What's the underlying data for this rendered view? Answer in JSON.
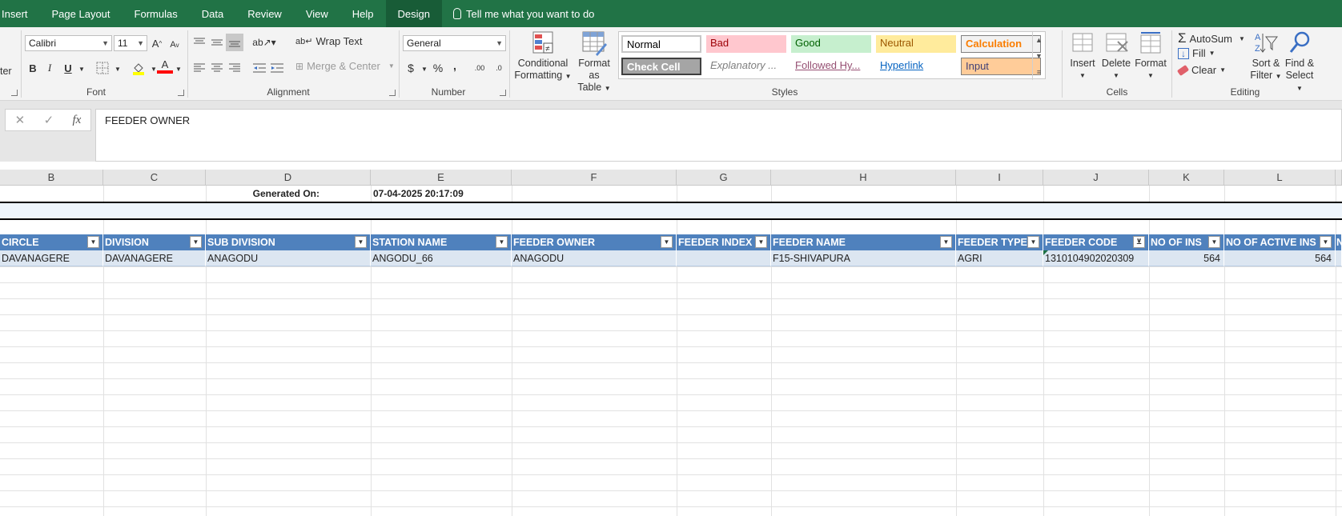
{
  "tabs": [
    {
      "label": "Insert"
    },
    {
      "label": "Page Layout"
    },
    {
      "label": "Formulas"
    },
    {
      "label": "Data"
    },
    {
      "label": "Review"
    },
    {
      "label": "View"
    },
    {
      "label": "Help"
    },
    {
      "label": "Design"
    }
  ],
  "tell_me": "Tell me what you want to do",
  "ribbon": {
    "clipboard_partial": "ter",
    "font": {
      "name": "Calibri",
      "size": "11",
      "group_label": "Font",
      "grow": "A",
      "shrink": "A",
      "bold": "B",
      "italic": "I",
      "underline": "U",
      "font_color": "A"
    },
    "alignment": {
      "wrap_text": "Wrap Text",
      "merge_center": "Merge & Center",
      "group_label": "Alignment"
    },
    "number": {
      "format": "General",
      "currency": "$",
      "percent": "%",
      "comma": ",",
      "inc_decimal": ".00",
      "dec_decimal": ".0",
      "group_label": "Number"
    },
    "styles": {
      "conditional_formatting_l1": "Conditional",
      "conditional_formatting_l2": "Formatting",
      "format_as_table_l1": "Format as",
      "format_as_table_l2": "Table",
      "cells": [
        {
          "label": "Normal",
          "bg": "#ffffff",
          "color": "#000000"
        },
        {
          "label": "Bad",
          "bg": "#ffc7ce",
          "color": "#9c0006"
        },
        {
          "label": "Good",
          "bg": "#c6efce",
          "color": "#006100"
        },
        {
          "label": "Neutral",
          "bg": "#ffeb9c",
          "color": "#9c5700"
        },
        {
          "label": "Calculation",
          "bg": "#f2f2f2",
          "color": "#fa7d00"
        },
        {
          "label": "Check Cell",
          "bg": "#a5a5a5",
          "color": "#ffffff"
        },
        {
          "label": "Explanatory ...",
          "bg": "#ffffff",
          "color": "#7f7f7f"
        },
        {
          "label": "Followed Hy...",
          "bg": "#ffffff",
          "color": "#954f72"
        },
        {
          "label": "Hyperlink",
          "bg": "#ffffff",
          "color": "#0563c1"
        },
        {
          "label": "Input",
          "bg": "#ffcc99",
          "color": "#3f3f76"
        }
      ],
      "group_label": "Styles"
    },
    "cells": {
      "insert": "Insert",
      "delete": "Delete",
      "format": "Format",
      "group_label": "Cells"
    },
    "editing": {
      "autosum": "AutoSum",
      "fill": "Fill",
      "clear": "Clear",
      "sort_filter_l1": "Sort &",
      "sort_filter_l2": "Filter",
      "find_select_l1": "Find &",
      "find_select_l2": "Select",
      "group_label": "Editing"
    }
  },
  "formula_bar": {
    "cancel": "✕",
    "enter": "✓",
    "fx": "fx",
    "content": "FEEDER OWNER"
  },
  "columns": [
    "B",
    "C",
    "D",
    "E",
    "F",
    "G",
    "H",
    "I",
    "J",
    "K",
    "L"
  ],
  "generated_label": "Generated On:",
  "generated_value": "07-04-2025 20:17:09",
  "table": {
    "headers": [
      "CIRCLE",
      "DIVISION",
      "SUB DIVISION",
      "STATION NAME",
      "FEEDER OWNER",
      "FEEDER INDEX",
      "FEEDER NAME",
      "FEEDER TYPE",
      "FEEDER CODE",
      "NO OF INS",
      "NO OF ACTIVE INS"
    ],
    "header_overflow": "N",
    "row": [
      "DAVANAGERE",
      "DAVANAGERE",
      "ANAGODU",
      "ANGODU_66",
      "ANAGODU",
      "",
      "F15-SHIVAPURA",
      "AGRI",
      "1310104902020309",
      "564",
      "564"
    ]
  },
  "colors": {
    "excel_green": "#217346",
    "table_header": "#4f81bd",
    "table_row": "#dce6f1",
    "banded_band": "#eef5fc"
  }
}
